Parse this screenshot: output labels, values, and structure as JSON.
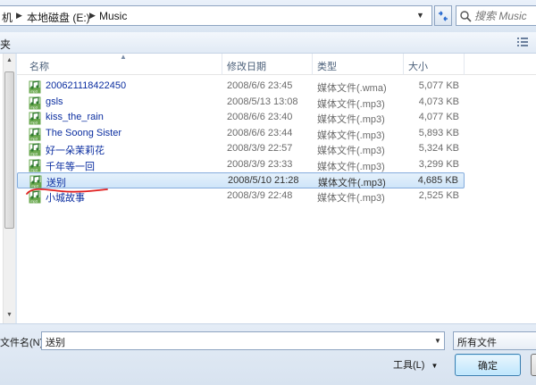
{
  "address": {
    "crumbs": [
      "机",
      "本地磁盘 (E:)",
      "Music"
    ],
    "search_placeholder": "搜索 Music"
  },
  "toolbar": {
    "label": "夹"
  },
  "columns": {
    "name": "名称",
    "date": "修改日期",
    "type": "类型",
    "size": "大小"
  },
  "files": [
    {
      "name": "200621118422450",
      "date": "2008/6/6 23:45",
      "type": "媒体文件(.wma)",
      "size": "5,077 KB",
      "selected": false
    },
    {
      "name": "gsls",
      "date": "2008/5/13 13:08",
      "type": "媒体文件(.mp3)",
      "size": "4,073 KB",
      "selected": false
    },
    {
      "name": "kiss_the_rain",
      "date": "2008/6/6 23:40",
      "type": "媒体文件(.mp3)",
      "size": "4,077 KB",
      "selected": false
    },
    {
      "name": "The Soong Sister",
      "date": "2008/6/6 23:44",
      "type": "媒体文件(.mp3)",
      "size": "5,893 KB",
      "selected": false
    },
    {
      "name": "好一朵茉莉花",
      "date": "2008/3/9 22:57",
      "type": "媒体文件(.mp3)",
      "size": "5,324 KB",
      "selected": false
    },
    {
      "name": "千年等一回",
      "date": "2008/3/9 23:33",
      "type": "媒体文件(.mp3)",
      "size": "3,299 KB",
      "selected": false
    },
    {
      "name": "送别",
      "date": "2008/5/10 21:28",
      "type": "媒体文件(.mp3)",
      "size": "4,685 KB",
      "selected": true
    },
    {
      "name": "小城故事",
      "date": "2008/3/9 22:48",
      "type": "媒体文件(.mp3)",
      "size": "2,525 KB",
      "selected": false
    }
  ],
  "bottom": {
    "filename_label": "文件名(N):",
    "filename_value": "送别",
    "filetype_value": "所有文件",
    "tools_label": "工具(L)",
    "tools_arrow": "▼",
    "ok_label": "确定"
  },
  "icons": {
    "file_icon": "music-file-icon",
    "refresh": "refresh-icon",
    "search": "search-icon",
    "views": "view-options-icon"
  },
  "colors": {
    "file_name": "#0b2ea0",
    "selection_bg": "#cfe5f9",
    "annotation_red": "#e02020"
  }
}
